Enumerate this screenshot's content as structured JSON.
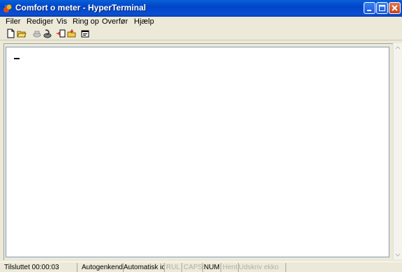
{
  "window": {
    "title": "Comfort o meter - HyperTerminal",
    "controls": [
      "minimize",
      "maximize",
      "close"
    ]
  },
  "menu": [
    "Filer",
    "Rediger",
    "Vis",
    "Ring op",
    "Overfør",
    "Hjælp"
  ],
  "toolbar": {
    "icons": [
      "new-document-icon",
      "open-folder-icon",
      "connect-icon",
      "disconnect-icon",
      "send-file-icon",
      "receive-file-icon",
      "properties-icon"
    ]
  },
  "terminal": {
    "content": ""
  },
  "status": {
    "connection": "Tilsluttet 00:00:03",
    "detect": "Autogenkend",
    "mode": "Automatisk ic",
    "scroll": "RUL",
    "caps": "CAPS",
    "num": "NUM",
    "capture": "Hent",
    "echo": "Udskriv ekko"
  },
  "colors": {
    "titlebar": "#0a4fd4",
    "chrome": "#ece9d8",
    "terminal_bg": "#ffffff",
    "dim_text": "#b3b0a3"
  }
}
